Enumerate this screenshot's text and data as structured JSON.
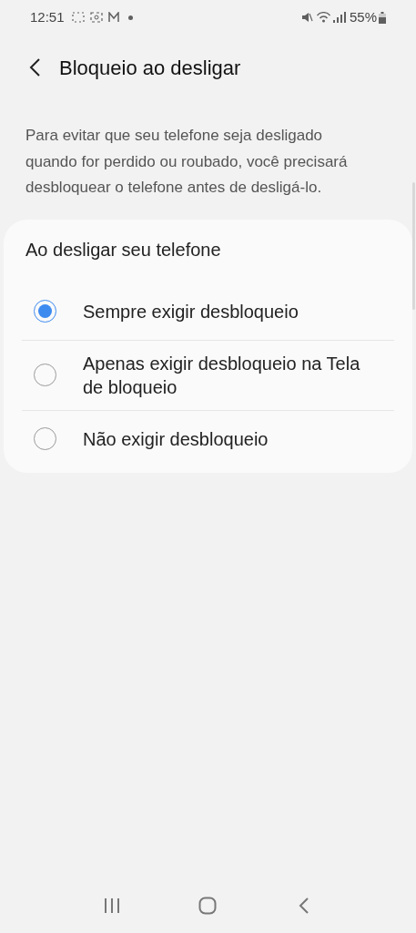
{
  "status_bar": {
    "time": "12:51",
    "battery": "55%"
  },
  "header": {
    "title": "Bloqueio ao desligar"
  },
  "description": "Para evitar que seu telefone seja desligado quando for perdido ou roubado, você precisará desbloquear o telefone antes de desligá-lo.",
  "card": {
    "title": "Ao desligar seu telefone",
    "options": [
      {
        "label": "Sempre exigir desbloqueio",
        "selected": true
      },
      {
        "label": "Apenas exigir desbloqueio na Tela de bloqueio",
        "selected": false
      },
      {
        "label": "Não exigir desbloqueio",
        "selected": false
      }
    ]
  }
}
